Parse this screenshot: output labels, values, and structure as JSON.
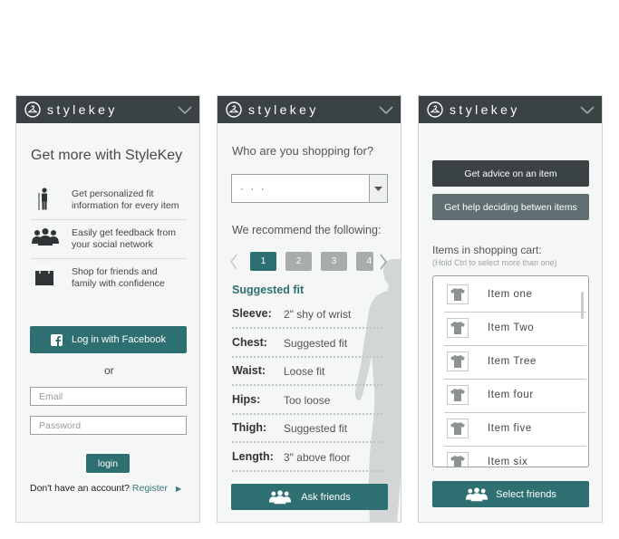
{
  "brand": "stylekey",
  "colors": {
    "header": "#3b4243",
    "teal": "#2e6f72",
    "dark_button": "#3b4243",
    "grey_button": "#5f6e70",
    "page_active": "#2e6f72",
    "page_inactive": "#a7acac"
  },
  "login": {
    "title": "Get more with StyleKey",
    "features": [
      {
        "icon": "person-fit-icon",
        "line1": "Get personalized fit",
        "line2": "information for every item"
      },
      {
        "icon": "group-icon",
        "line1": "Easily get feedback from",
        "line2": "your social network"
      },
      {
        "icon": "shopping-bag-icon",
        "line1": "Shop for friends and",
        "line2": "family with confidence"
      }
    ],
    "facebook_button": "Log in with Facebook",
    "or_text": "or",
    "email_placeholder": "Email",
    "password_placeholder": "Password",
    "login_button": "login",
    "no_account_text": "Don't have an account?",
    "register_link": "Register"
  },
  "recommend": {
    "question": "Who are you shopping for?",
    "select_value": "· · ·",
    "recommend_label": "We recommend the following:",
    "pages": [
      "1",
      "2",
      "3",
      "4"
    ],
    "active_page": "1",
    "suggested_heading": "Suggested fit",
    "fit_rows": [
      {
        "label": "Sleeve:",
        "value": "2\" shy of wrist"
      },
      {
        "label": "Chest:",
        "value": "Suggested fit"
      },
      {
        "label": "Waist:",
        "value": "Loose fit"
      },
      {
        "label": "Hips:",
        "value": "Too loose"
      },
      {
        "label": "Thigh:",
        "value": "Suggested fit"
      },
      {
        "label": "Length:",
        "value": "3\" above floor"
      }
    ],
    "ask_friends_button": "Ask friends"
  },
  "cart": {
    "advice_button": "Get advice on an item",
    "help_button": "Get help deciding betwen items",
    "cart_label": "Items in shopping cart:",
    "cart_hint": "(Hold Ctrl to select more than one)",
    "items": [
      "Item one",
      "Item Two",
      "Item Tree",
      "Item four",
      "Item five",
      "Item six"
    ],
    "select_friends_button": "Select friends"
  }
}
